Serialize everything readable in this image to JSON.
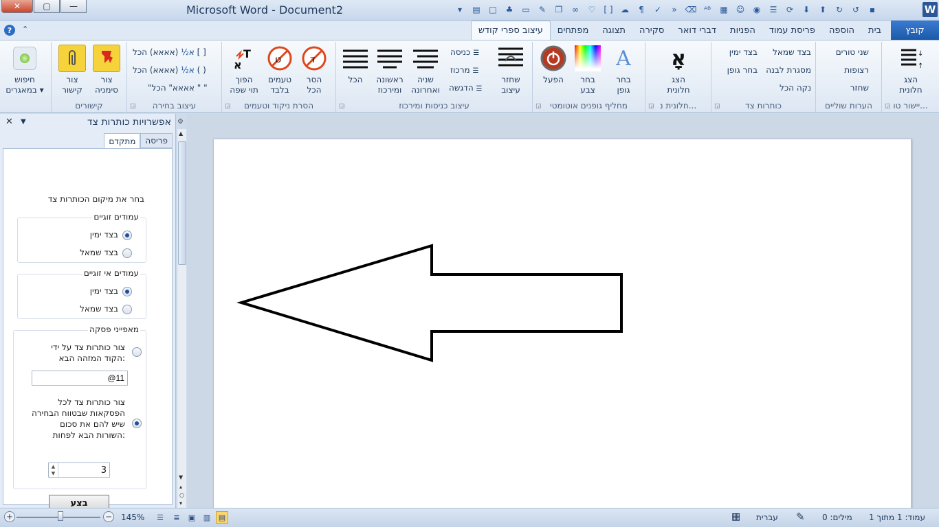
{
  "window": {
    "title": "Microsoft Word  -  Document2",
    "close_glyph": "✕",
    "max_glyph": "▢",
    "min_glyph": "—",
    "logo": "W"
  },
  "tabs": [
    {
      "label": "קובץ",
      "kind": "file"
    },
    {
      "label": "בית"
    },
    {
      "label": "הוספה"
    },
    {
      "label": "פריסת עמוד"
    },
    {
      "label": "הפניות"
    },
    {
      "label": "דברי דואר"
    },
    {
      "label": "סקירה"
    },
    {
      "label": "תצוגה"
    },
    {
      "label": "מפתחים"
    },
    {
      "label": "עיצוב ספרי קודש",
      "active": true
    }
  ],
  "ribbon": {
    "align": {
      "big_label_1": "הצג",
      "big_label_2": "חלונית",
      "group_label": "יישור טו..."
    },
    "footnotes": {
      "items": [
        "שני טורים",
        "רצופות",
        "שחזר"
      ],
      "group_label": "הערות שוליים"
    },
    "marginal": {
      "items": [
        "בצד ימין",
        "בצד שמאל",
        "בחר גופן",
        "מסגרת לבנה",
        "נקה הכל"
      ],
      "group_label": "כותרות צד"
    },
    "pane_group": {
      "big_label_1": "הצג",
      "big_label_2": "חלונית",
      "glyph": "אָ",
      "group_label": "חלונית נ..."
    },
    "fonts": {
      "b1_1": "בחר",
      "b1_2": "גופן",
      "b2_1": "בחר",
      "b2_2": "צבע",
      "b3": "הפעל",
      "group_label": "מחליף גופנים אוטומטי"
    },
    "indents": {
      "b_restore_1": "שחזר",
      "b_restore_2": "עיצוב",
      "small": [
        "כניסה",
        "מרכוז",
        "הדגשה"
      ],
      "b_second_1": "שניה",
      "b_second_2": "ואחרונה",
      "b_first_1": "ראשונה",
      "b_first_2": "ומירכוז",
      "b_all": "הכל",
      "group_label": "עיצוב כניסות ומירכוז"
    },
    "nikud": {
      "b1_1": "הסר",
      "b1_2": "הכל",
      "b2_1": "טעמים",
      "b2_2": "בלבד",
      "b3_1": "הפוך",
      "b3_2": "תוי שפה",
      "group_label": "הסרת ניקוד וטעמים"
    },
    "selection": {
      "items": [
        "(אאאא) הכל [ ]",
        "(אאאא) הכל ( )",
        "\"אאאא\" הכל \" \""
      ],
      "group_label": "עיצוב בחירה"
    },
    "links": {
      "b1_1": "צור",
      "b1_2": "סימניה",
      "b2_1": "צור",
      "b2_2": "קישור",
      "group_label": "קישורים"
    },
    "search": {
      "label_1": "חיפוש",
      "label_2": "במאגרים"
    }
  },
  "pane": {
    "title": "אפשרויות כותרות צד",
    "tabs": [
      "פריסה",
      "מתקדם"
    ],
    "active_tab": "מתקדם",
    "instruction": "בחר את מיקום הכותרות צד",
    "even_pages": {
      "legend": "עמודים זוגיים",
      "right": "בצד ימין",
      "left": "בצד שמאל",
      "selected": "right"
    },
    "odd_pages": {
      "legend": "עמודים אי זוגיים",
      "right": "בצד ימין",
      "left": "בצד שמאל",
      "selected": "right"
    },
    "paragraph": {
      "legend": "מאפייני פסקה",
      "option1": "צור כותרות צד על ידי הקוד המזהה הבא:",
      "code_value": "@11",
      "option2": "צור כותרות צד לכל הפסקאות שבטווח הבחירה שיש להם את סכום השורות הבא לפחות:",
      "lines_value": "3",
      "selected": "option2"
    },
    "apply_label": "בצע"
  },
  "status": {
    "page": "עמוד: 1 מתוך 1",
    "words": "מילים: 0",
    "language": "עברית",
    "zoom": "145%",
    "zoom_fraction": 0.45
  },
  "document": {
    "shape": "left-arrow outline"
  }
}
